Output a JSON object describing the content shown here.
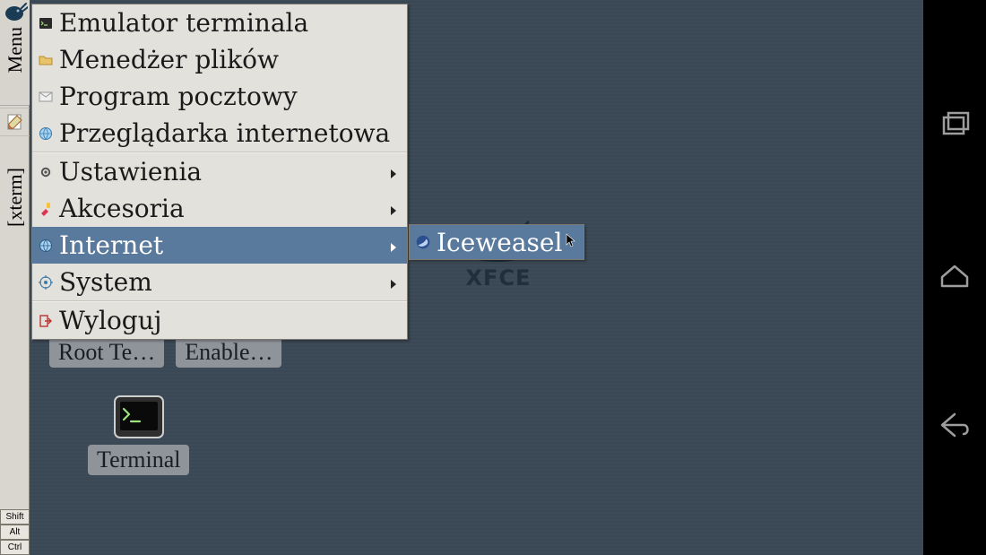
{
  "leftbar": {
    "menu_label": "Menu",
    "xterm_label": "[xterm]",
    "keys": [
      "Shift",
      "Alt",
      "Ctrl"
    ]
  },
  "desktop": {
    "xfce_label": "XFCE",
    "shortcuts_row": [
      {
        "label": "Root Te…"
      },
      {
        "label": "Enable…"
      }
    ],
    "terminal_label": "Terminal"
  },
  "menu": {
    "items": [
      {
        "key": "terminal",
        "label": "Emulator terminala",
        "icon": "terminal-icon",
        "submenu": false
      },
      {
        "key": "files",
        "label": "Menedżer plików",
        "icon": "folder-icon",
        "submenu": false
      },
      {
        "key": "mail",
        "label": "Program pocztowy",
        "icon": "mail-icon",
        "submenu": false
      },
      {
        "key": "browser",
        "label": "Przeglądarka internetowa",
        "icon": "globe-icon",
        "submenu": false
      }
    ],
    "sep1": true,
    "items2": [
      {
        "key": "settings",
        "label": "Ustawienia",
        "icon": "gear-icon",
        "submenu": true
      },
      {
        "key": "accessories",
        "label": "Akcesoria",
        "icon": "accessories-icon",
        "submenu": true
      },
      {
        "key": "internet",
        "label": "Internet",
        "icon": "globe-icon",
        "submenu": true,
        "highlight": true
      },
      {
        "key": "system",
        "label": "System",
        "icon": "system-icon",
        "submenu": true
      }
    ],
    "sep2": true,
    "items3": [
      {
        "key": "logout",
        "label": "Wyloguj",
        "icon": "logout-icon",
        "submenu": false
      }
    ]
  },
  "submenu": {
    "parent": "internet",
    "items": [
      {
        "key": "iceweasel",
        "label": "Iceweasel",
        "icon": "iceweasel-icon"
      }
    ]
  },
  "navbar": {
    "buttons": [
      "recent-apps",
      "home",
      "back"
    ]
  }
}
